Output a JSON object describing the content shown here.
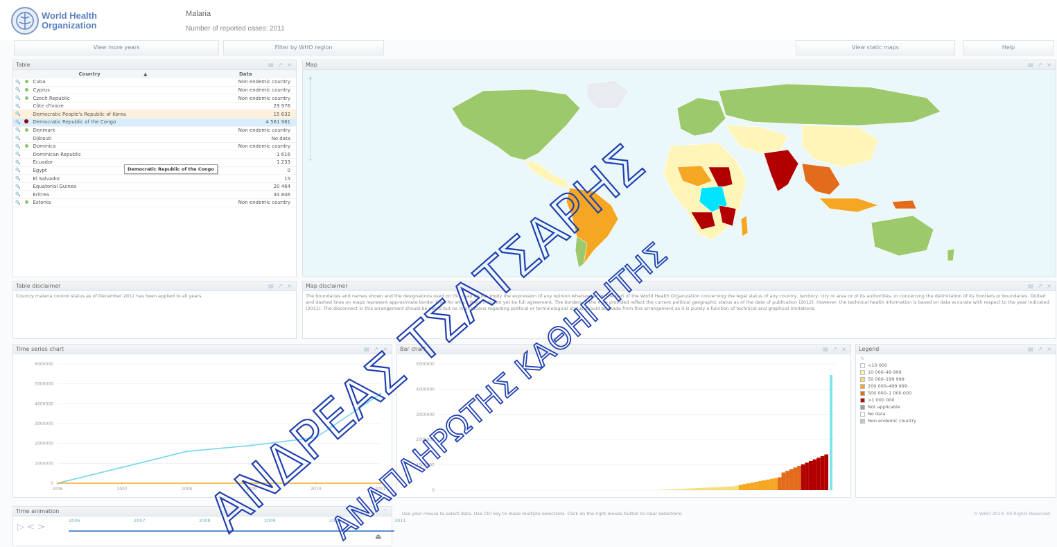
{
  "header": {
    "logo_line1": "World Health",
    "logo_line2": "Organization",
    "title": "Malaria",
    "subtitle": "Number of reported cases: 2011"
  },
  "toolbar": {
    "view_more_years": "View more years",
    "filter_region": "Filter by WHO region",
    "view_static_maps": "View static maps",
    "help": "Help"
  },
  "table_panel": {
    "title": "Table",
    "col_country": "Country",
    "col_data": "Data",
    "sort_icon": "sort-asc-icon",
    "rows": [
      {
        "country": "Cuba",
        "data": "Non endemic country",
        "dot": "green"
      },
      {
        "country": "Cyprus",
        "data": "Non endemic country",
        "dot": "green"
      },
      {
        "country": "Czech Republic",
        "data": "Non endemic country",
        "dot": "green"
      },
      {
        "country": "Côte d'Ivoire",
        "data": "29 976",
        "dot": ""
      },
      {
        "country": "Democratic People's Republic of Korea",
        "data": "15 632",
        "dot": "",
        "highlight": "orange"
      },
      {
        "country": "Democratic Republic of the Congo",
        "data": "4 561 981",
        "dot": "red",
        "highlight": "blue"
      },
      {
        "country": "Denmark",
        "data": "Non endemic country",
        "dot": "green"
      },
      {
        "country": "Djibouti",
        "data": "No data",
        "dot": ""
      },
      {
        "country": "Dominica",
        "data": "Non endemic country",
        "dot": "green"
      },
      {
        "country": "Dominican Republic",
        "data": "1 616",
        "dot": ""
      },
      {
        "country": "Ecuador",
        "data": "1 233",
        "dot": ""
      },
      {
        "country": "Egypt",
        "data": "0",
        "dot": ""
      },
      {
        "country": "El Salvador",
        "data": "15",
        "dot": ""
      },
      {
        "country": "Equatorial Guinea",
        "data": "20 464",
        "dot": ""
      },
      {
        "country": "Eritrea",
        "data": "34 846",
        "dot": ""
      },
      {
        "country": "Estonia",
        "data": "Non endemic country",
        "dot": "green"
      }
    ],
    "tooltip": "Democratic Republic of the Congo"
  },
  "map_panel": {
    "title": "Map"
  },
  "table_disclaimer": {
    "title": "Table disclaimer",
    "text": "Country malaria control status as of December 2012 has been applied to all years."
  },
  "map_disclaimer": {
    "title": "Map disclaimer",
    "text": "The boundaries and names shown and the designations used on this map do not imply the expression of any opinion whatsoever on the part of the World Health Organization concerning the legal status of any country, territory, city or area or of its authorities, or concerning the delimitation of its frontiers or boundaries. Dotted and dashed lines on maps represent approximate border lines for which there may not yet be full agreement. The borders of the map provided reflect the current political geographic status as of the date of publication (2012). However, the technical health information is based on data accurate with respect to the year indicated (2011). The disconnect in this arrangement should be noted but no implications regarding political or terminological status should be made from this arrangement as it is purely a function of technical and graphical limitations."
  },
  "time_series": {
    "title": "Time series chart"
  },
  "bar_chart": {
    "title": "Bar chart"
  },
  "legend": {
    "title": "Legend",
    "items": [
      {
        "label": "<10 000",
        "color": "#ffffff"
      },
      {
        "label": "10 000–49 999",
        "color": "#fff5b8"
      },
      {
        "label": "50 000–199 999",
        "color": "#f7dc7a"
      },
      {
        "label": "200 000–499 999",
        "color": "#f5a623"
      },
      {
        "label": "500 000–1 000 000",
        "color": "#e36b1c"
      },
      {
        "label": ">1 000 000",
        "color": "#b20000"
      },
      {
        "label": "Not applicable",
        "color": "#9aa0a6"
      },
      {
        "label": "No data",
        "color": "#ffffff"
      },
      {
        "label": "Non endemic country",
        "color": "#c8c8c8"
      }
    ]
  },
  "time_animation": {
    "title": "Time animation",
    "years": [
      "2006",
      "2007",
      "2008",
      "2009",
      "2010",
      "2011"
    ]
  },
  "footer": {
    "hint": "Use your mouse to select data. Use Ctrl key to make multiple selections. Click on the right mouse button to clear selections.",
    "copyright": "© WHO 2013. All Rights Reserved"
  },
  "watermark": {
    "line1": "ΑΝΔΡΕΑΣ ΤΣΑΤΣΑΡΗΣ",
    "line2": "ΑΝΑΠΛΗΡΩΤΗΣ ΚΑΘΗΓΗΤΗΣ"
  },
  "chart_data": [
    {
      "type": "line",
      "x": [
        "2006",
        "2007",
        "2008",
        "2009",
        "2010",
        "2011"
      ],
      "ylim": [
        0,
        6000000
      ],
      "yticks": [
        "0",
        "1000000",
        "2000000",
        "3000000",
        "4000000",
        "5000000",
        "6000000"
      ],
      "series": [
        {
          "values": [
            0,
            800000,
            1600000,
            1900000,
            2300000,
            4500000
          ],
          "color": "#7fd8ec"
        },
        {
          "values": [
            0,
            0,
            0,
            0,
            0,
            0
          ],
          "color": "#f2b640"
        }
      ]
    },
    {
      "type": "bar",
      "ylim": [
        0,
        5000000
      ],
      "yticks": [
        "0",
        "1000000",
        "2000000",
        "3000000",
        "4000000",
        "5000000"
      ],
      "highlight_value": 4561981,
      "highlight_color": "#7fe3f0"
    }
  ]
}
